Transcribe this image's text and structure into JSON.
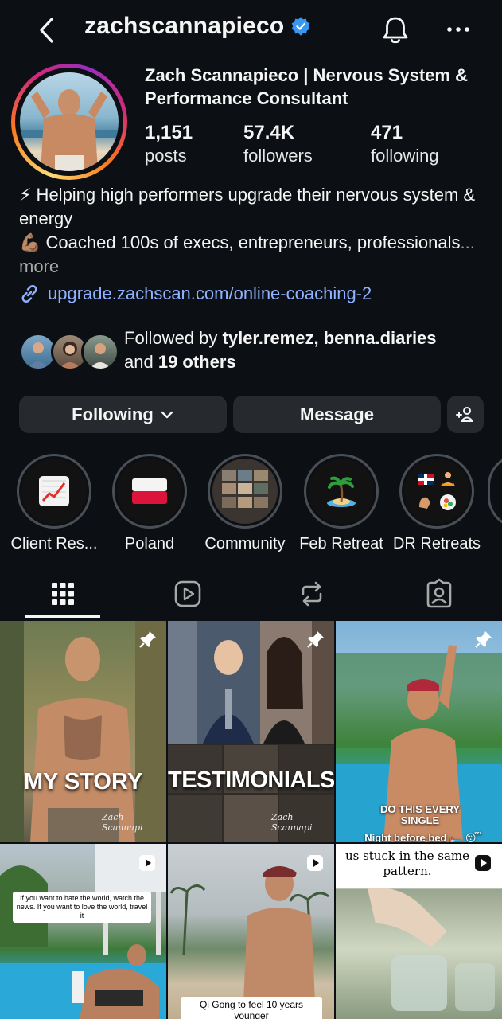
{
  "header": {
    "username": "zachscannapieco",
    "verified": true
  },
  "profile": {
    "full_name": "Zach Scannapieco | Nervous System & Performance Consultant",
    "stats": [
      {
        "value": "1,151",
        "label": "posts"
      },
      {
        "value": "57.4K",
        "label": "followers"
      },
      {
        "value": "471",
        "label": "following"
      }
    ],
    "bio_line1": "⚡ Helping high performers upgrade their nervous system & energy",
    "bio_line2": "💪🏽 Coached 100s of execs, entrepreneurs, professionals",
    "bio_more": "... more",
    "link": "upgrade.zachscan.com/online-coaching-2"
  },
  "followed_by": {
    "prefix": "Followed by ",
    "names": "tyler.remez, benna.diaries",
    "and": "and ",
    "others": "19 others"
  },
  "actions": {
    "following_label": "Following",
    "message_label": "Message"
  },
  "highlights": [
    {
      "label": "Client Res...",
      "icon": "📈"
    },
    {
      "label": "Poland",
      "icon": "🇵🇱"
    },
    {
      "label": "Community",
      "icon": "community-collage"
    },
    {
      "label": "Feb Retreat",
      "icon": "🏝️"
    },
    {
      "label": "DR Retreats",
      "icon": "🇩🇴🧘💪🥗"
    }
  ],
  "tabs": [
    "grid-icon",
    "reels-icon",
    "reposts-icon",
    "tagged-icon"
  ],
  "posts": [
    {
      "caption": "MY STORY",
      "signature": "Zach Scannapi",
      "pinned": true
    },
    {
      "caption": "TESTIMONIALS",
      "signature": "Zach Scannapi",
      "pinned": true
    },
    {
      "caption": "DO THIS EVERY SINGLE",
      "overlay": "Night before bed 🛏️ 😴",
      "pinned": true
    },
    {
      "caption": "If you want to hate the world, watch the news. If you want to love the world, travel it",
      "reel": true
    },
    {
      "caption": "Qi Gong to feel 10 years younger",
      "reel": true
    },
    {
      "caption": "us stuck in the same pattern.",
      "reel": true
    }
  ],
  "colors": {
    "background": "#0c1014",
    "button": "#26292e",
    "link": "#8fb1ff",
    "verified": "#3897f0"
  }
}
